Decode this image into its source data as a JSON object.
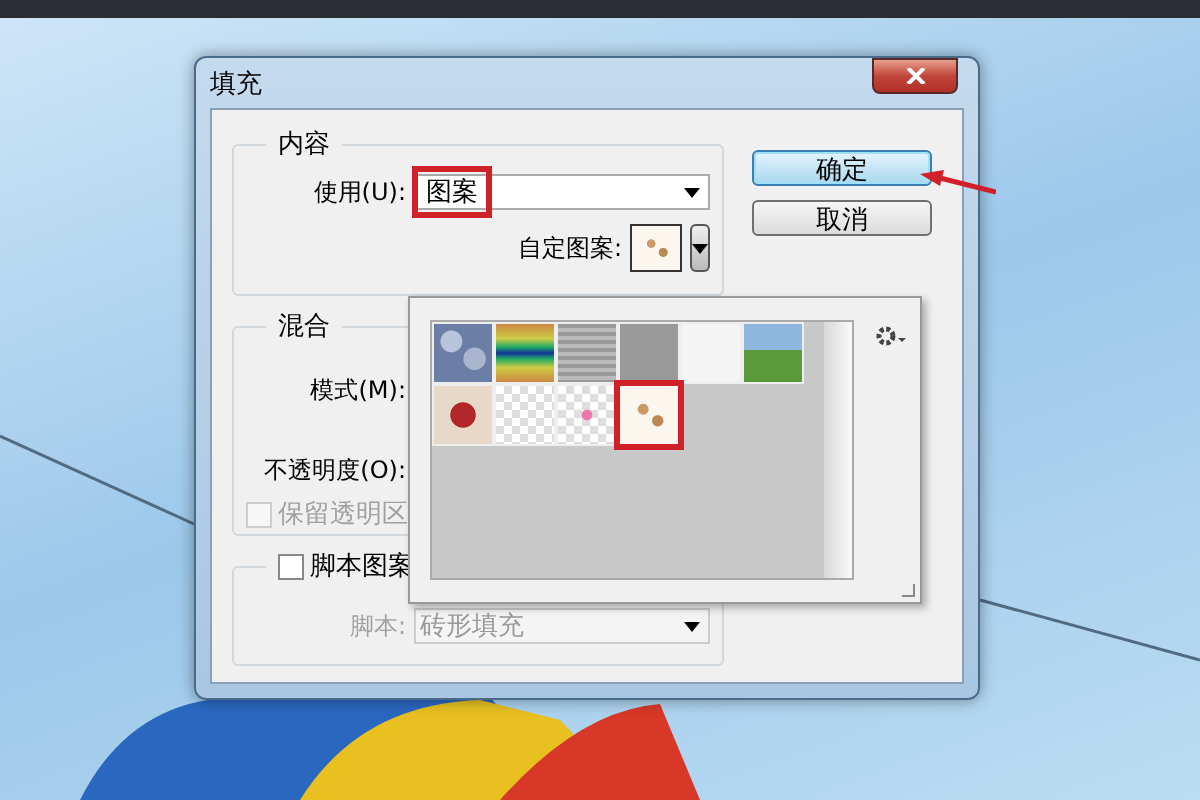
{
  "window": {
    "title": "填充"
  },
  "content_group": {
    "title": "内容",
    "use": {
      "label": "使用(U):",
      "value": "图案"
    },
    "custom_pattern": {
      "label": "自定图案:"
    }
  },
  "blend_group": {
    "title": "混合",
    "mode": {
      "label": "模式(M):"
    },
    "opacity": {
      "label": "不透明度(O):"
    },
    "preserve_transparency": {
      "label": "保留透明区",
      "checked": false,
      "disabled": true
    }
  },
  "script_group": {
    "enabled": {
      "label": "脚本图案",
      "checked": false
    },
    "script": {
      "label": "脚本:",
      "value": "砖形填充",
      "disabled": true
    }
  },
  "buttons": [
    {
      "label": "确定",
      "default": true
    },
    {
      "label": "取消",
      "default": false
    }
  ],
  "pattern_picker": {
    "patterns": [
      {
        "kind": "bubbles",
        "selected": false
      },
      {
        "kind": "rainbow",
        "selected": false
      },
      {
        "kind": "lines",
        "selected": false
      },
      {
        "kind": "gray",
        "selected": false
      },
      {
        "kind": "blank",
        "selected": false
      },
      {
        "kind": "grass",
        "selected": false
      },
      {
        "kind": "flower",
        "selected": false
      },
      {
        "kind": "checker",
        "selected": false
      },
      {
        "kind": "heart",
        "selected": false
      },
      {
        "kind": "floral",
        "selected": true
      }
    ]
  }
}
